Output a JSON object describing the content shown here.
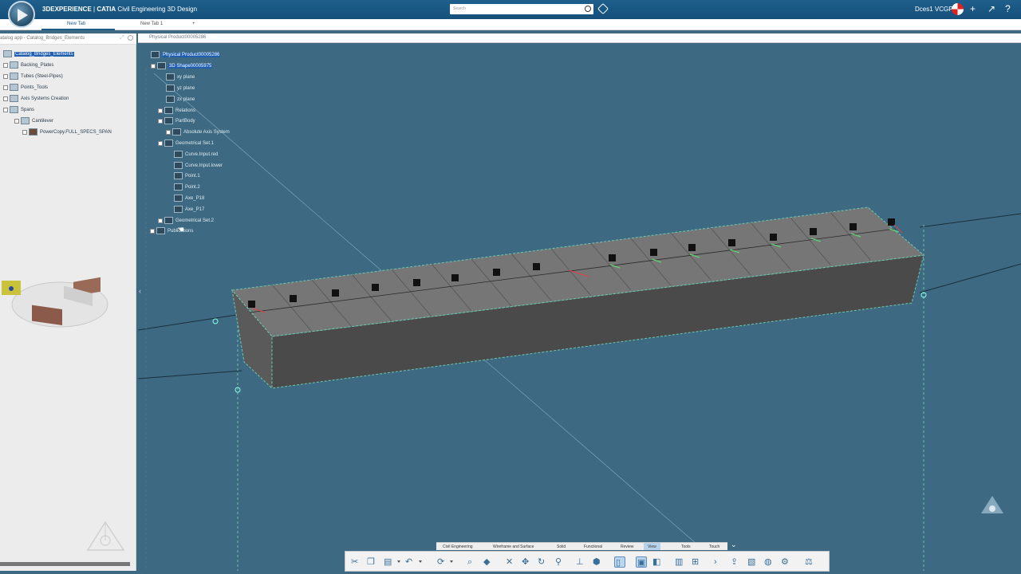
{
  "app": {
    "brand": "3DEXPERIENCE",
    "product": "CATIA",
    "title": "Civil Engineering 3D Design",
    "user": "Dces1 VCGP"
  },
  "search": {
    "placeholder": "Search"
  },
  "tabs": [
    {
      "label": "New Tab",
      "active": true
    },
    {
      "label": "New Tab 1",
      "active": false
    },
    {
      "label": "+",
      "active": false
    }
  ],
  "left_panel": {
    "header": "atalog app - Catalog_Bridges_Elements",
    "tree": [
      {
        "label": "Catalog_Bridges_Elements",
        "selected": true
      },
      {
        "label": "Backing_Plates"
      },
      {
        "label": "Tubes (Steel-Pipes)"
      },
      {
        "label": "Points_Tools"
      },
      {
        "label": "Axis Systems Creation"
      },
      {
        "label": "Spans"
      },
      {
        "label": "Cantilever"
      },
      {
        "label": "PowerCopy.FULL_SPECS_SPAN"
      }
    ]
  },
  "viewport": {
    "header": "Physical Product00005286",
    "tree": [
      {
        "label": "Physical Product00005286",
        "selected": true
      },
      {
        "label": "3D Shape00005975",
        "selected": true
      },
      {
        "label": "xy plane"
      },
      {
        "label": "yz plane"
      },
      {
        "label": "zx plane"
      },
      {
        "label": "Relations"
      },
      {
        "label": "PartBody"
      },
      {
        "label": "Absolute Axis System"
      },
      {
        "label": "Geometrical Set.1"
      },
      {
        "label": "Curve.Input.red"
      },
      {
        "label": "Curve.Input.lower"
      },
      {
        "label": "Point.1"
      },
      {
        "label": "Point.2"
      },
      {
        "label": "Axe_P18"
      },
      {
        "label": "Axe_P17"
      },
      {
        "label": "Geometrical Set.2"
      },
      {
        "label": "Publications"
      }
    ]
  },
  "action_bar": {
    "tabs": [
      {
        "label": "Civil Engineering"
      },
      {
        "label": "Wireframe and Surface"
      },
      {
        "label": "Solid"
      },
      {
        "label": "Functional"
      },
      {
        "label": "Review"
      },
      {
        "label": "View",
        "active": true
      },
      {
        "label": "Tools"
      },
      {
        "label": "Touch"
      }
    ]
  },
  "colors": {
    "accent": "#1e5b86",
    "viewport_bg": "#3d6a82",
    "selection": "#1f5fae"
  }
}
